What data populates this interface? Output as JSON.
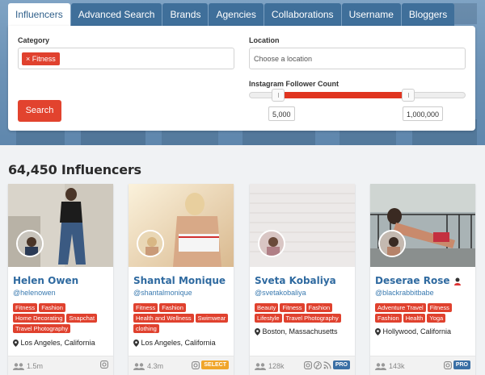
{
  "tabs": [
    {
      "label": "Influencers"
    },
    {
      "label": "Advanced Search"
    },
    {
      "label": "Brands"
    },
    {
      "label": "Agencies"
    },
    {
      "label": "Collaborations"
    },
    {
      "label": "Username"
    },
    {
      "label": "Bloggers"
    }
  ],
  "search": {
    "category_label": "Category",
    "category_chip": "× Fitness",
    "location_label": "Location",
    "location_placeholder": "Choose a location",
    "follower_label": "Instagram Follower Count",
    "min_value": "5,000",
    "max_value": "1,000,000",
    "range_min_fraction": 0.13,
    "range_max_fraction": 0.73,
    "search_button": "Search"
  },
  "results_title": "64,450 Influencers",
  "colors": {
    "accent": "#e0412e",
    "tab": "#3f6f9a",
    "link": "#2f6aa0",
    "pro": "#3a6fa5",
    "select": "#f0a52a"
  },
  "cards": [
    {
      "name": "Helen Owen",
      "handle": "@helenowen",
      "tags": [
        "Fitness",
        "Fashion",
        "Home Decorating",
        "Snapchat",
        "Travel Photography"
      ],
      "location": "Los Angeles, California",
      "followers": "1.5m",
      "badge": "",
      "badge_icons": [
        "instagram-icon"
      ]
    },
    {
      "name": "Shantal Monique",
      "handle": "@shantalmonique",
      "tags": [
        "Fitness",
        "Fashion",
        "Health and Wellness",
        "Swimwear",
        "clothing"
      ],
      "location": "Los Angeles, California",
      "followers": "4.3m",
      "badge": "SELECT",
      "badge_icons": [
        "instagram-icon"
      ]
    },
    {
      "name": "Sveta Kobaliya",
      "handle": "@svetakobaliya",
      "tags": [
        "Beauty",
        "Fitness",
        "Fashion",
        "Lifestyle",
        "Travel Photography"
      ],
      "location": "Boston, Massachusetts",
      "followers": "128k",
      "badge": "PRO",
      "badge_icons": [
        "instagram-icon",
        "pinterest-icon",
        "rss-icon"
      ]
    },
    {
      "name": "Deserae Rose",
      "handle": "@blackrabbitbabe",
      "tags": [
        "Adventure Travel",
        "Fitness",
        "Fashion",
        "Health",
        "Yoga"
      ],
      "location": "Hollywood, California",
      "followers": "143k",
      "badge": "PRO",
      "badge_icons": [
        "instagram-icon"
      ]
    }
  ]
}
